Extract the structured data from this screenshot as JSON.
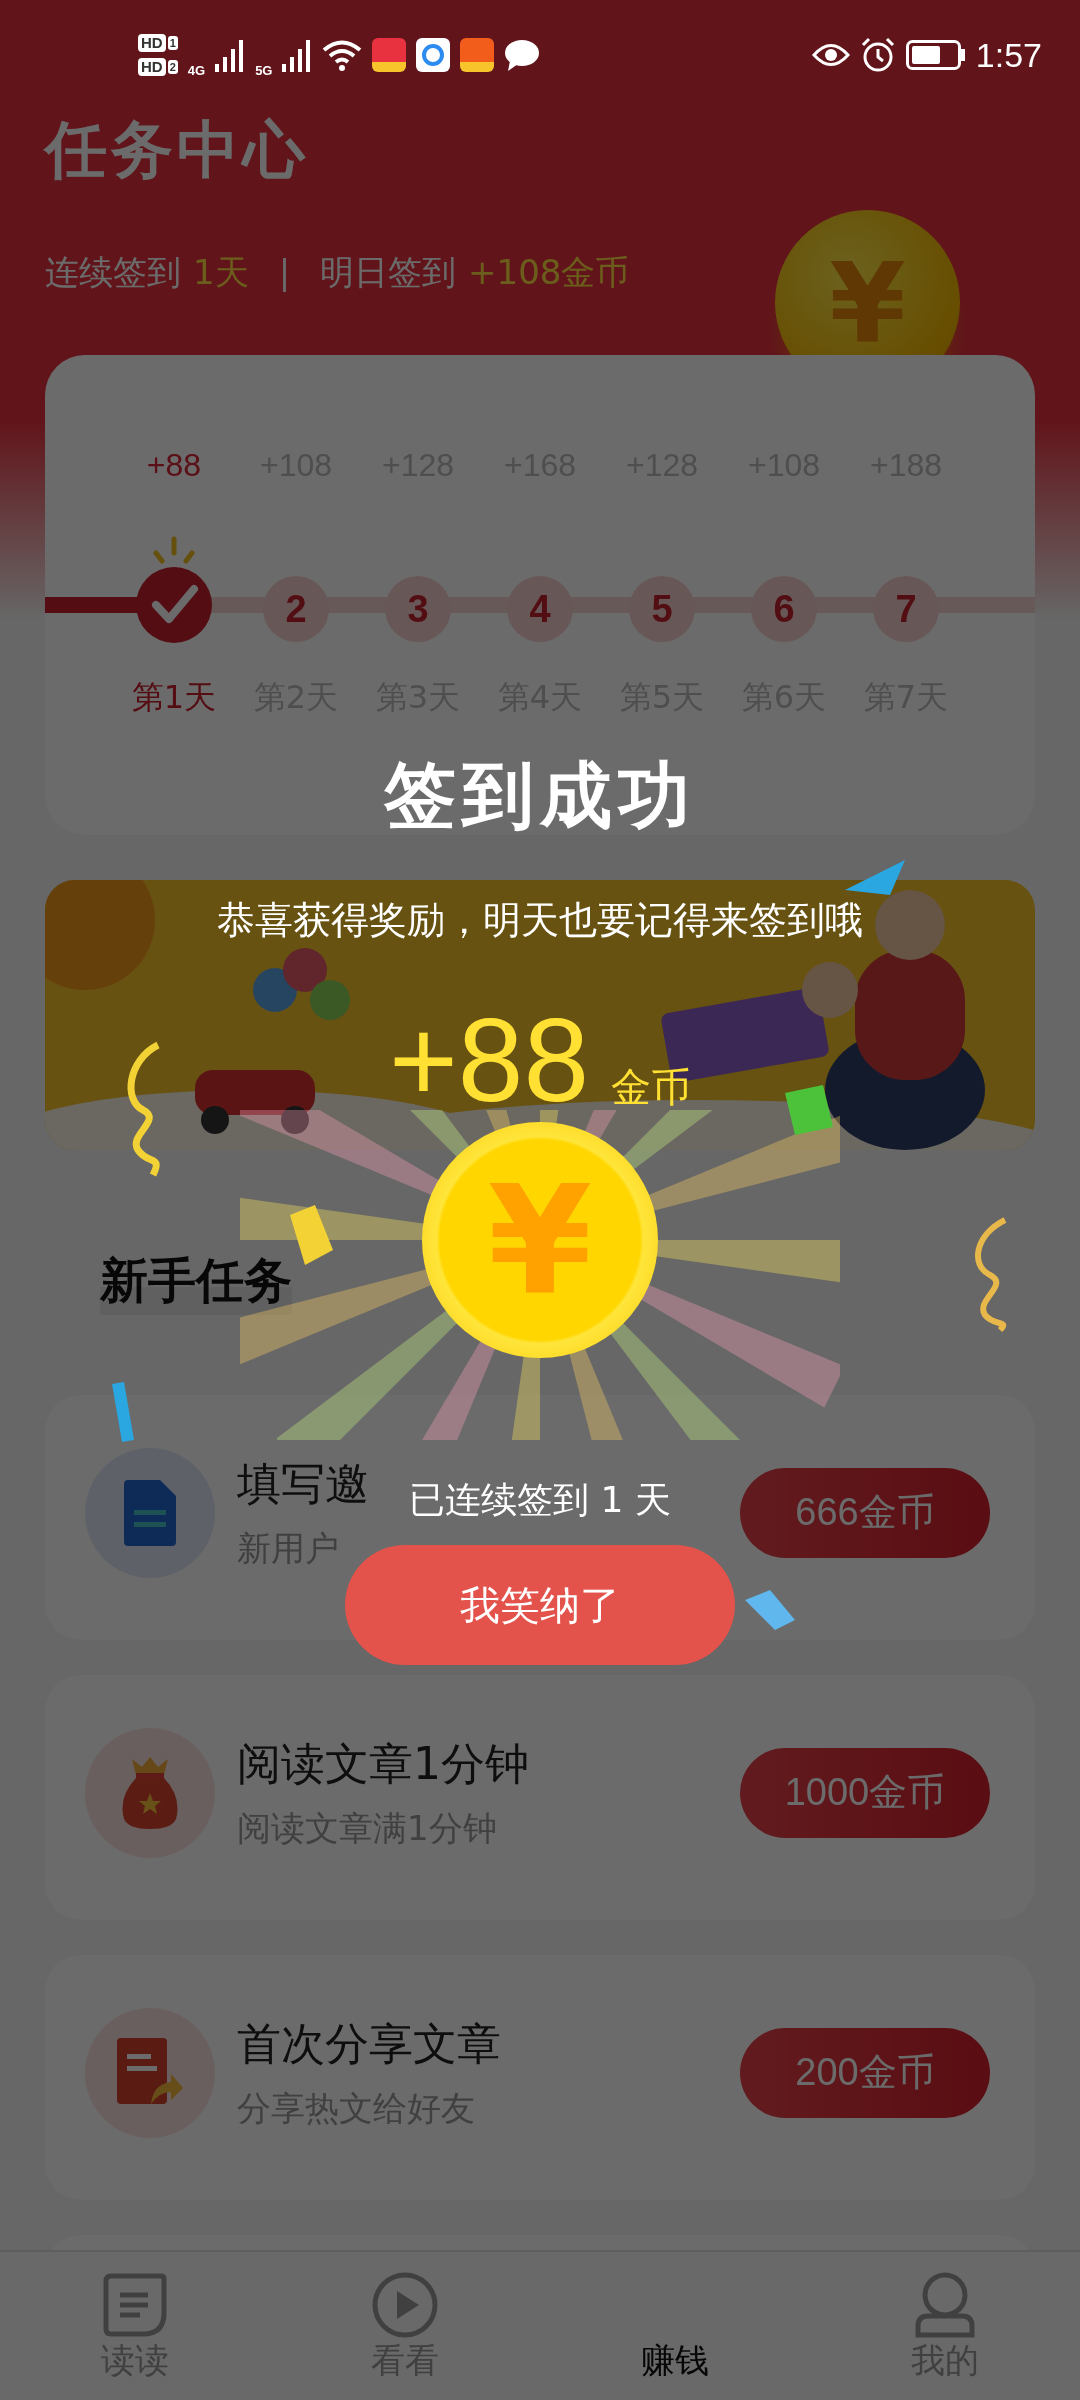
{
  "status_bar": {
    "sims": [
      {
        "badge": "HD",
        "slot": "1",
        "network": "4G"
      },
      {
        "badge": "HD",
        "slot": "2",
        "network": "5G"
      }
    ],
    "time": "1:57"
  },
  "header": {
    "title": "任务中心",
    "streak_label": "连续签到",
    "streak_value": "1天",
    "separator": "|",
    "tomorrow_label": "明日签到",
    "tomorrow_value": "+108金币",
    "coin_symbol": "¥"
  },
  "days": [
    {
      "reward": "+88",
      "label": "第1天",
      "checked": true
    },
    {
      "reward": "+108",
      "number": "2",
      "label": "第2天",
      "checked": false
    },
    {
      "reward": "+128",
      "number": "3",
      "label": "第3天",
      "checked": false
    },
    {
      "reward": "+168",
      "number": "4",
      "label": "第4天",
      "checked": false
    },
    {
      "reward": "+128",
      "number": "5",
      "label": "第5天",
      "checked": false
    },
    {
      "reward": "+108",
      "number": "6",
      "label": "第6天",
      "checked": false
    },
    {
      "reward": "+188",
      "number": "7",
      "label": "第7天",
      "checked": false
    }
  ],
  "section_title": "新手任务",
  "tasks": [
    {
      "kind": "document",
      "title": "填写邀",
      "subtitle": "新用户",
      "reward": "666金币"
    },
    {
      "kind": "bag",
      "title": "阅读文章1分钟",
      "subtitle": "阅读文章满1分钟",
      "reward": "1000金币"
    },
    {
      "kind": "share",
      "title": "首次分享文章",
      "subtitle": "分享热文给好友",
      "reward": "200金币"
    }
  ],
  "nav": [
    {
      "label": "读读",
      "kind": "article",
      "selected": false
    },
    {
      "label": "看看",
      "kind": "play",
      "selected": false
    },
    {
      "label": "赚钱",
      "kind": "plain",
      "selected": true
    },
    {
      "label": "我的",
      "kind": "person",
      "selected": false
    }
  ],
  "popup": {
    "title": "签到成功",
    "message": "恭喜获得奖励，明天也要记得来签到哦",
    "amount": "+88",
    "unit": "金币",
    "coin_symbol": "¥",
    "streak": "已连续签到 1 天",
    "button": "我笑纳了"
  }
}
